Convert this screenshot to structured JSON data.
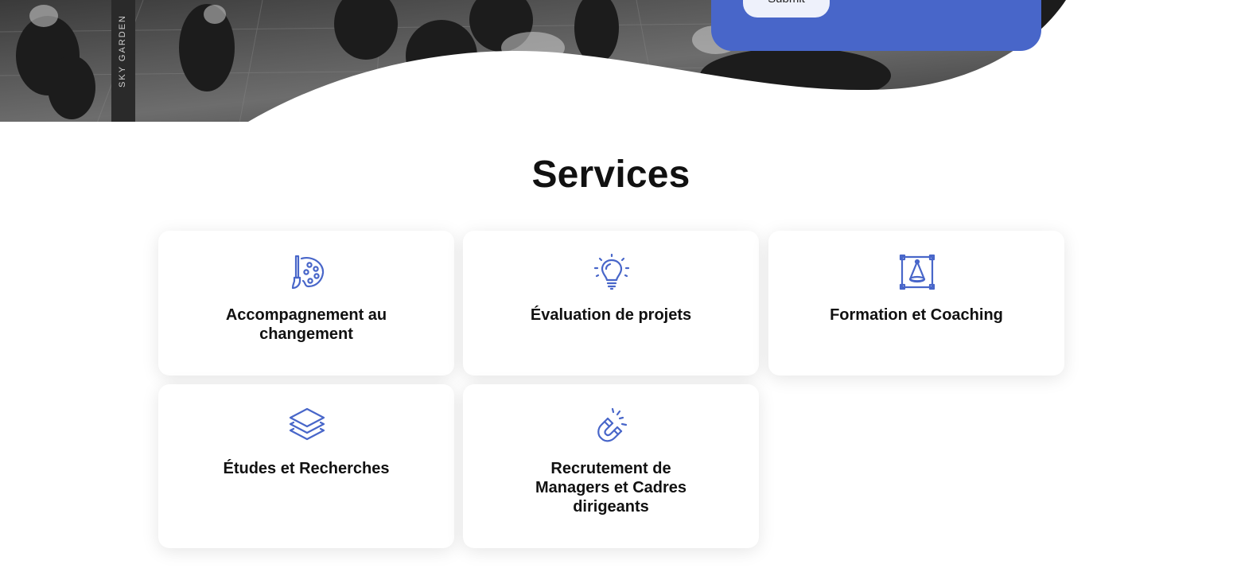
{
  "hero": {
    "photo_sign_text": "SKY GARDEN",
    "form": {
      "submit_label": "Submit"
    }
  },
  "services": {
    "title": "Services",
    "accent_color": "#4866c9",
    "items": [
      {
        "label": "Accompagnement au changement",
        "icon": "palette-brush-icon"
      },
      {
        "label": "Évaluation de projets",
        "icon": "lightbulb-icon"
      },
      {
        "label": "Formation et Coaching",
        "icon": "vector-frame-icon"
      },
      {
        "label": "Études et Recherches",
        "icon": "layers-icon"
      },
      {
        "label": "Recrutement de Managers et Cadres dirigeants",
        "icon": "magnet-icon"
      }
    ]
  }
}
